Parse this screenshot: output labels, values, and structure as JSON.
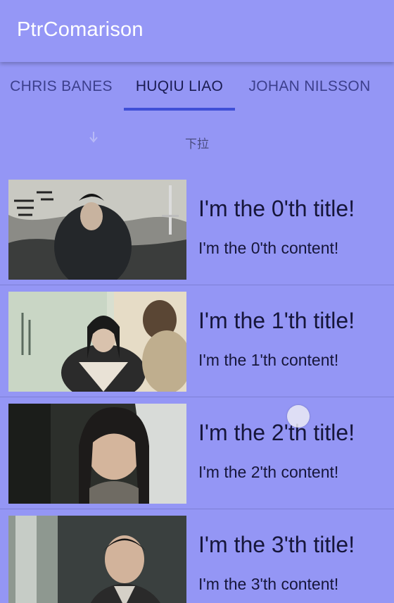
{
  "toolbar": {
    "title": "PtrComarison"
  },
  "tabs": [
    {
      "label": "CHRIS BANES",
      "active": false
    },
    {
      "label": "HUQIU LIAO",
      "active": true
    },
    {
      "label": "JOHAN NILSSON",
      "active": false
    }
  ],
  "pull_header": {
    "text": "下拉",
    "icon": "arrow-down-icon"
  },
  "list": {
    "items": [
      {
        "title": "I'm the 0'th title!",
        "content": "I'm the 0'th content!"
      },
      {
        "title": "I'm the 1'th title!",
        "content": "I'm the 1'th content!"
      },
      {
        "title": "I'm the 2'th title!",
        "content": "I'm the 2'th content!"
      },
      {
        "title": "I'm the 3'th title!",
        "content": "I'm the 3'th content!"
      }
    ]
  },
  "colors": {
    "background": "#9496f5",
    "tab_indicator": "#3f4fd6",
    "text_dark": "#16163a"
  }
}
